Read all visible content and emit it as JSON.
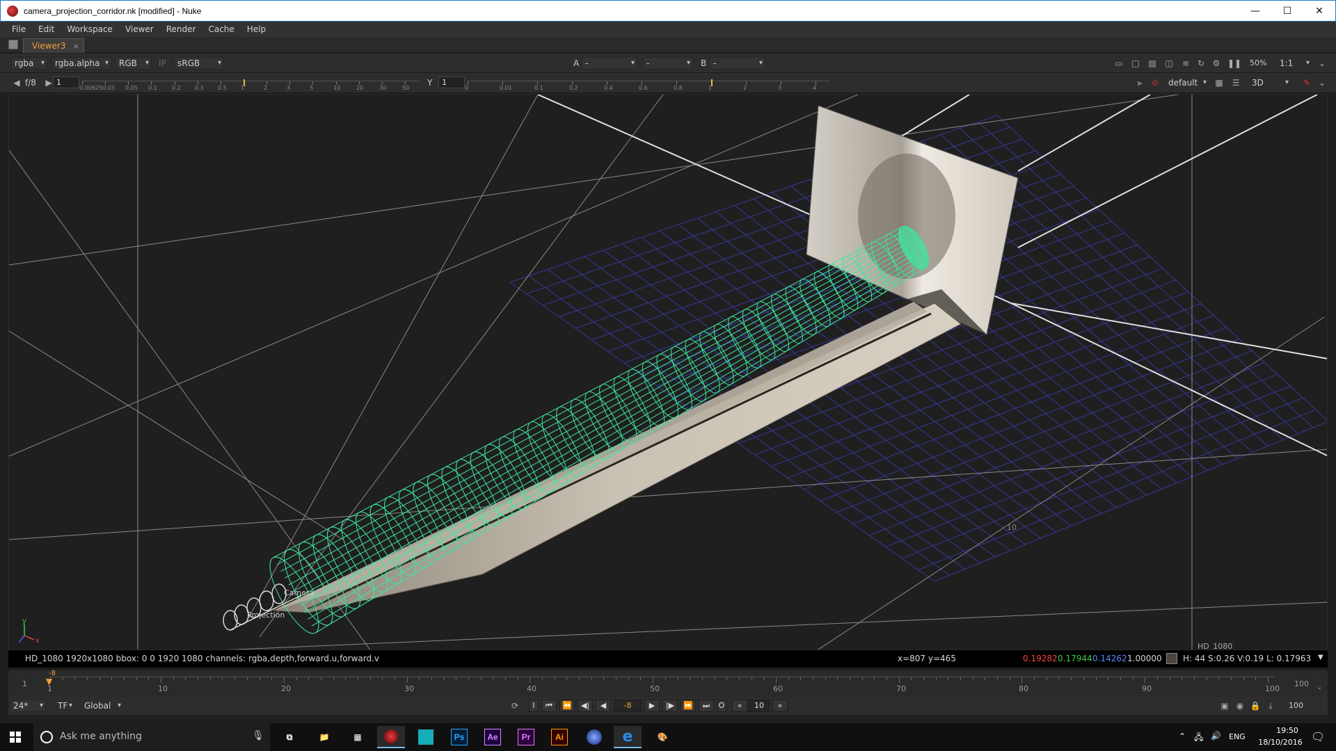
{
  "window": {
    "title": "camera_projection_corridor.nk [modified] - Nuke",
    "minimize_label": "—",
    "maximize_label": "☐",
    "close_label": "✕"
  },
  "menu": {
    "items": [
      "File",
      "Edit",
      "Workspace",
      "Viewer",
      "Render",
      "Cache",
      "Help"
    ]
  },
  "tabs": {
    "active_label": "Viewer3",
    "close_label": "×"
  },
  "toolbar1": {
    "channels": "rgba",
    "alpha": "rgba.alpha",
    "display": "RGB",
    "ip_label": "IP",
    "lut": "sRGB",
    "input_a_label": "A",
    "input_a_value": "-",
    "wipe_value": "-",
    "input_b_label": "B",
    "input_b_value": "-",
    "zoom": "50%",
    "ratio": "1:1"
  },
  "toolbar2": {
    "fstop": "f/8",
    "gain_value": "1",
    "gain_ticks": [
      "0.00625",
      "0.03",
      "0.05",
      "0.1",
      "0.2",
      "0.3",
      "0.5",
      "1",
      "2",
      "3",
      "5",
      "10",
      "20",
      "30",
      "50"
    ],
    "gamma_label": "Y",
    "gamma_value": "1",
    "gamma_ticks": [
      "0",
      "0.01",
      "0.1",
      "0.2",
      "0.4",
      "0.6",
      "0.8",
      "1",
      "2",
      "3",
      "4"
    ],
    "view_preset": "default",
    "view_mode": "3D"
  },
  "viewport": {
    "axis_y": "y",
    "axis_x": "x",
    "camera_label_1": "Camera",
    "camera_label_2": "Projection",
    "grid_label": "10",
    "format_label": "HD_1080",
    "wire_color": "#3ee6a0",
    "grid_color": "#3a3aa8"
  },
  "infobar": {
    "format": "HD_1080 1920x1080  bbox: 0 0 1920 1080 channels: rgba,depth,forward.u,forward.v",
    "coords": "x=807 y=465",
    "r": "0.19282",
    "g": "0.17944",
    "b": "0.14262",
    "a": "1.00000",
    "hsvl": "H: 44 S:0.26 V:0.19  L: 0.17963",
    "r_color": "#ff4040",
    "g_color": "#40d040",
    "b_color": "#5a8aff"
  },
  "timeline": {
    "start": "1",
    "end": "100",
    "current": "-8",
    "ticks": [
      "1",
      "10",
      "20",
      "30",
      "40",
      "50",
      "60",
      "70",
      "80",
      "90",
      "100"
    ]
  },
  "playback": {
    "fps": "24*",
    "tf": "TF",
    "scope": "Global",
    "frame": "-8",
    "increment": "10",
    "end_frame": "100"
  },
  "taskbar": {
    "search_placeholder": "Ask me anything",
    "language": "ENG",
    "time": "19:50",
    "date": "18/10/2016",
    "apps": [
      {
        "name": "Ps",
        "color": "#31a8ff",
        "bg": "#001e36"
      },
      {
        "name": "Ae",
        "color": "#d291ff",
        "bg": "#1f0040"
      },
      {
        "name": "Pr",
        "color": "#e77cf4",
        "bg": "#2a003f"
      },
      {
        "name": "Ai",
        "color": "#ff9a00",
        "bg": "#330000"
      }
    ]
  }
}
